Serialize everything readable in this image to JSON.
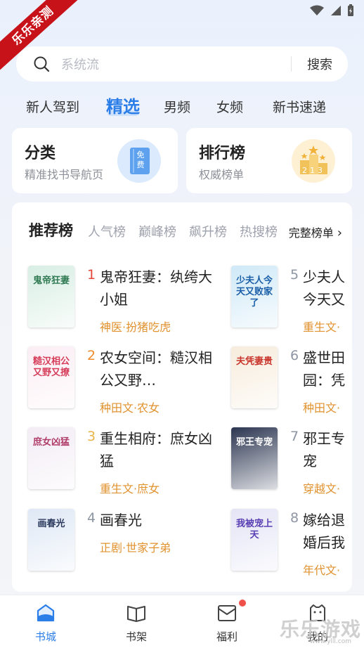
{
  "ribbon": {
    "text": "乐乐亲测"
  },
  "search": {
    "placeholder": "系统流",
    "button": "搜索"
  },
  "tabs": [
    {
      "label": "新人驾到",
      "active": false
    },
    {
      "label": "精选",
      "active": true
    },
    {
      "label": "男频",
      "active": false
    },
    {
      "label": "女频",
      "active": false
    },
    {
      "label": "新书速递",
      "active": false
    }
  ],
  "quick_cards": [
    {
      "title": "分类",
      "subtitle": "精准找书导航页",
      "icon": "category-book-icon",
      "icon_text": "免费"
    },
    {
      "title": "排行榜",
      "subtitle": "权威榜单",
      "icon": "podium-icon",
      "icon_text": "213"
    }
  ],
  "ranking": {
    "title": "推荐榜",
    "tabs": [
      "人气榜",
      "巅峰榜",
      "飙升榜",
      "热搜榜"
    ],
    "full_link": "完整榜单",
    "books": [
      {
        "rank": "1",
        "title": "鬼帝狂妻：纨绔大小姐",
        "tag": "神医·扮猪吃虎",
        "rank_color": "#e5483a",
        "cover_text": "鬼帝狂妻",
        "cover_bg": "#d8eee4",
        "cover_fg": "#2f7a52"
      },
      {
        "rank": "2",
        "title": "农女空间：糙汉相公又野…",
        "tag": "种田文·农女",
        "rank_color": "#ef8a2b",
        "cover_text": "糙汉相公又野又撩",
        "cover_bg": "#fbeef4",
        "cover_fg": "#d63d5a"
      },
      {
        "rank": "3",
        "title": "重生相府：庶女凶猛",
        "tag": "重生文·庶女",
        "rank_color": "#e8b34a",
        "cover_text": "庶女凶猛",
        "cover_bg": "#f3ecf5",
        "cover_fg": "#b03c6a"
      },
      {
        "rank": "4",
        "title": "画春光",
        "tag": "正剧·世家子弟",
        "rank_color": "#8e95a3",
        "cover_text": "画春光",
        "cover_bg": "#dfe8f5",
        "cover_fg": "#2c3a5e"
      },
      {
        "rank": "5",
        "title": "少夫人今天又败家了",
        "tag": "重生文·",
        "rank_color": "#8e95a3",
        "cover_text": "少夫人今天又败家了",
        "cover_bg": "#cfe9f7",
        "cover_fg": "#1b5fa8"
      },
      {
        "rank": "6",
        "title": "盛世田园：凭妻贵",
        "tag": "种田文·",
        "rank_color": "#8e95a3",
        "cover_text": "夫凭妻贵",
        "cover_bg": "#f7ecdc",
        "cover_fg": "#c9342a"
      },
      {
        "rank": "7",
        "title": "邪王专宠",
        "tag": "穿越文·",
        "rank_color": "#8e95a3",
        "cover_text": "邪王专宠",
        "cover_bg": "#2b3550",
        "cover_fg": "#ffffff"
      },
      {
        "rank": "8",
        "title": "嫁给退婚后我被宠上天",
        "tag": "年代文·",
        "rank_color": "#8e95a3",
        "cover_text": "我被宠上天",
        "cover_bg": "#e4e4f6",
        "cover_fg": "#5a3fb3"
      }
    ]
  },
  "bottom_nav": [
    {
      "label": "书城",
      "icon": "home-icon",
      "active": true
    },
    {
      "label": "书架",
      "icon": "bookshelf-icon",
      "active": false
    },
    {
      "label": "福利",
      "icon": "gift-icon",
      "active": false,
      "badge": true
    },
    {
      "label": "我的",
      "icon": "profile-icon",
      "active": false
    }
  ],
  "watermark": {
    "text": "乐乐游戏",
    "url": "www.ylll.com"
  },
  "colors": {
    "accent": "#2b7de8",
    "tag": "#e0922f",
    "badge": "#f0504a"
  }
}
